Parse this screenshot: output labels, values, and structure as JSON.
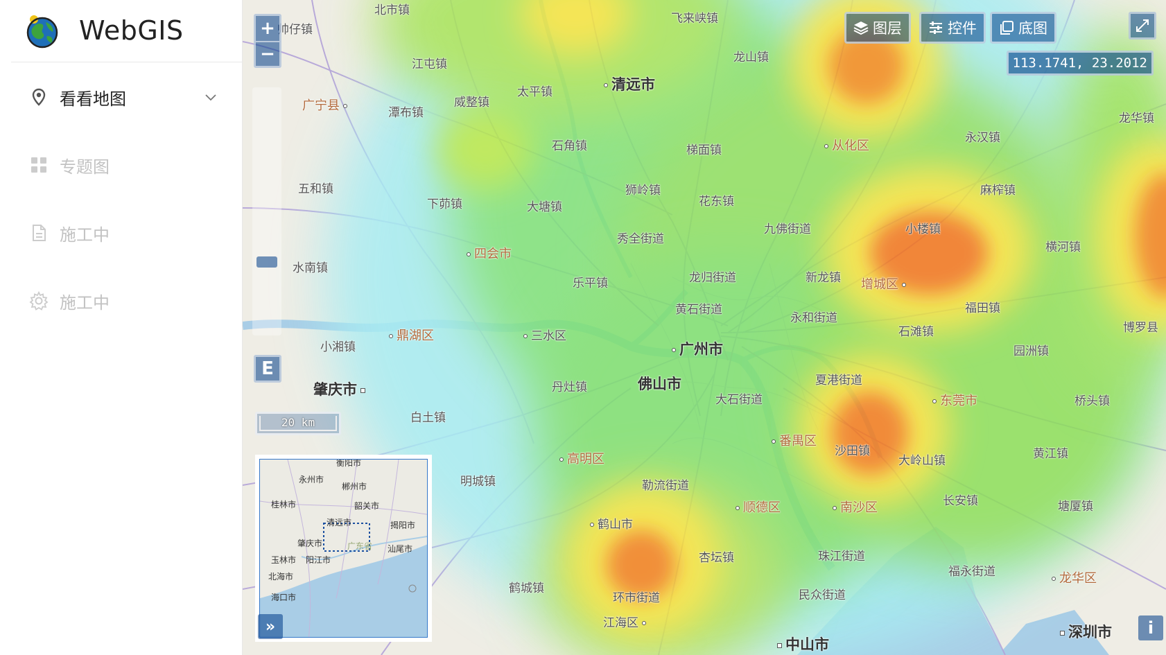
{
  "app": {
    "title": "WebGIS"
  },
  "sidebar": {
    "items": [
      {
        "label": "看看地图",
        "icon": "map-pin-icon",
        "state": "active"
      },
      {
        "label": "专题图",
        "icon": "grid-icon",
        "state": "disabled"
      },
      {
        "label": "施工中",
        "icon": "document-icon",
        "state": "disabled"
      },
      {
        "label": "施工中",
        "icon": "gear-icon",
        "state": "disabled"
      }
    ]
  },
  "map": {
    "zoom_in_label": "+",
    "zoom_out_label": "−",
    "extent_label": "E",
    "expand_overview_label": "»",
    "info_label": "i",
    "toolbar": {
      "layers": "图层",
      "controls": "控件",
      "basemap": "底图"
    },
    "coordinates": "113.1741, 23.2012",
    "scale": "20 km",
    "places": [
      {
        "name": "北市镇"
      },
      {
        "name": "帅仔镇"
      },
      {
        "name": "飞来峡镇"
      },
      {
        "name": "江屯镇"
      },
      {
        "name": "龙山镇"
      },
      {
        "name": "广宁县"
      },
      {
        "name": "潭布镇"
      },
      {
        "name": "威整镇"
      },
      {
        "name": "太平镇"
      },
      {
        "name": "清远市"
      },
      {
        "name": "龙华镇"
      },
      {
        "name": "石角镇"
      },
      {
        "name": "梯面镇"
      },
      {
        "name": "从化区"
      },
      {
        "name": "永汉镇"
      },
      {
        "name": "五和镇"
      },
      {
        "name": "下茆镇"
      },
      {
        "name": "大塘镇"
      },
      {
        "name": "狮岭镇"
      },
      {
        "name": "花东镇"
      },
      {
        "name": "麻榨镇"
      },
      {
        "name": "秀全街道"
      },
      {
        "name": "九佛街道"
      },
      {
        "name": "小楼镇"
      },
      {
        "name": "横河镇"
      },
      {
        "name": "四会市"
      },
      {
        "name": "水南镇"
      },
      {
        "name": "乐平镇"
      },
      {
        "name": "龙归街道"
      },
      {
        "name": "新龙镇"
      },
      {
        "name": "增城区"
      },
      {
        "name": "黄石街道"
      },
      {
        "name": "永和街道"
      },
      {
        "name": "福田镇"
      },
      {
        "name": "博罗县"
      },
      {
        "name": "鼎湖区"
      },
      {
        "name": "三水区"
      },
      {
        "name": "广州市"
      },
      {
        "name": "石滩镇"
      },
      {
        "name": "园洲镇"
      },
      {
        "name": "小湘镇"
      },
      {
        "name": "肇庆市"
      },
      {
        "name": "丹灶镇"
      },
      {
        "name": "佛山市"
      },
      {
        "name": "夏港街道"
      },
      {
        "name": "大石街道"
      },
      {
        "name": "东莞市"
      },
      {
        "name": "桥头镇"
      },
      {
        "name": "白土镇"
      },
      {
        "name": "番禺区"
      },
      {
        "name": "高明区"
      },
      {
        "name": "沙田镇"
      },
      {
        "name": "大岭山镇"
      },
      {
        "name": "黄江镇"
      },
      {
        "name": "明城镇"
      },
      {
        "name": "勒流街道"
      },
      {
        "name": "顺德区"
      },
      {
        "name": "南沙区"
      },
      {
        "name": "长安镇"
      },
      {
        "name": "塘厦镇"
      },
      {
        "name": "鹤山市"
      },
      {
        "name": "杏坛镇"
      },
      {
        "name": "珠江街道"
      },
      {
        "name": "福永街道"
      },
      {
        "name": "龙华区"
      },
      {
        "name": "鹤城镇"
      },
      {
        "name": "环市街道"
      },
      {
        "name": "民众街道"
      },
      {
        "name": "江海区"
      },
      {
        "name": "中山市"
      },
      {
        "name": "深圳市"
      }
    ],
    "overview_places": [
      {
        "name": "衡阳市"
      },
      {
        "name": "永州市"
      },
      {
        "name": "郴州市"
      },
      {
        "name": "桂林市"
      },
      {
        "name": "韶关市"
      },
      {
        "name": "清远市"
      },
      {
        "name": "揭阳市"
      },
      {
        "name": "肇庆市"
      },
      {
        "name": "广东省"
      },
      {
        "name": "汕尾市"
      },
      {
        "name": "玉林市"
      },
      {
        "name": "阳江市"
      },
      {
        "name": "北海市"
      },
      {
        "name": "海口市"
      }
    ]
  }
}
